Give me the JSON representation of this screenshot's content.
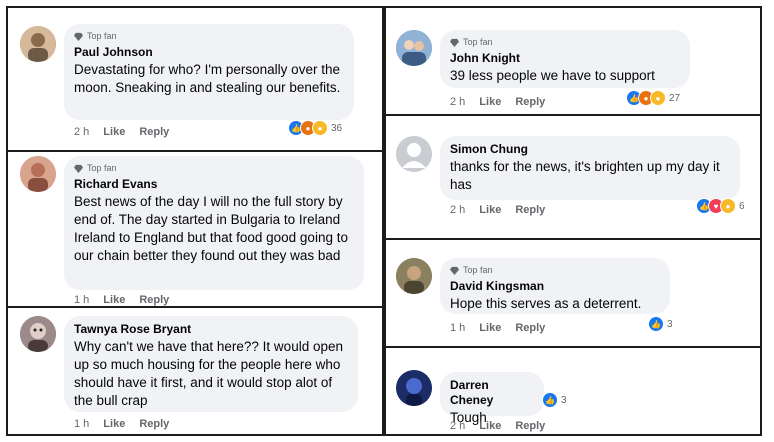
{
  "comments": [
    {
      "badge": "Top fan",
      "name": "Paul Johnson",
      "text": "Devastating for who? I'm personally over the moon. Sneaking in and stealing our benefits.",
      "time": "2 h",
      "like": "Like",
      "reply": "Reply",
      "reaction_count": "36",
      "avatar_color": "#b08968"
    },
    {
      "badge": "Top fan",
      "name": "Richard Evans",
      "text": "Best news of the day I will no the full story by end of. The day started in Bulgaria to Ireland Ireland to England but that food good going to our chain better they found out they was bad",
      "time": "1 h",
      "like": "Like",
      "reply": "Reply",
      "avatar_color": "#c08f7a"
    },
    {
      "badge": "",
      "name": "Tawnya Rose Bryant",
      "text": "Why can't we have that here?? It would open up so much housing for the people here who should have it first, and it would stop alot of the bull crap",
      "time": "1 h",
      "like": "Like",
      "reply": "Reply",
      "avatar_color": "#7a6a6a"
    },
    {
      "badge": "Top fan",
      "name": "John Knight",
      "text": "39 less people we have to support",
      "time": "2 h",
      "like": "Like",
      "reply": "Reply",
      "reaction_count": "27",
      "avatar_color": "#5a7fa8"
    },
    {
      "badge": "",
      "name": "Simon Chung",
      "text": "thanks for the news, it's brighten up my day it has",
      "time": "2 h",
      "like": "Like",
      "reply": "Reply",
      "reaction_count": "6",
      "avatar_color": "#c9ccd1"
    },
    {
      "badge": "Top fan",
      "name": "David Kingsman",
      "text": "Hope this serves as a deterrent.",
      "time": "1 h",
      "like": "Like",
      "reply": "Reply",
      "reaction_count": "3",
      "avatar_color": "#6f6548"
    },
    {
      "badge": "",
      "name": "Darren Cheney",
      "text": "Tough",
      "time": "2 h",
      "like": "Like",
      "reply": "Reply",
      "reaction_count": "3",
      "avatar_color": "#2a3f8a"
    }
  ],
  "colors": {
    "like": "#1877f2",
    "haha": "#f7b928",
    "angry": "#e9710f",
    "love": "#f33e58",
    "bubble": "#f0f2f5"
  }
}
